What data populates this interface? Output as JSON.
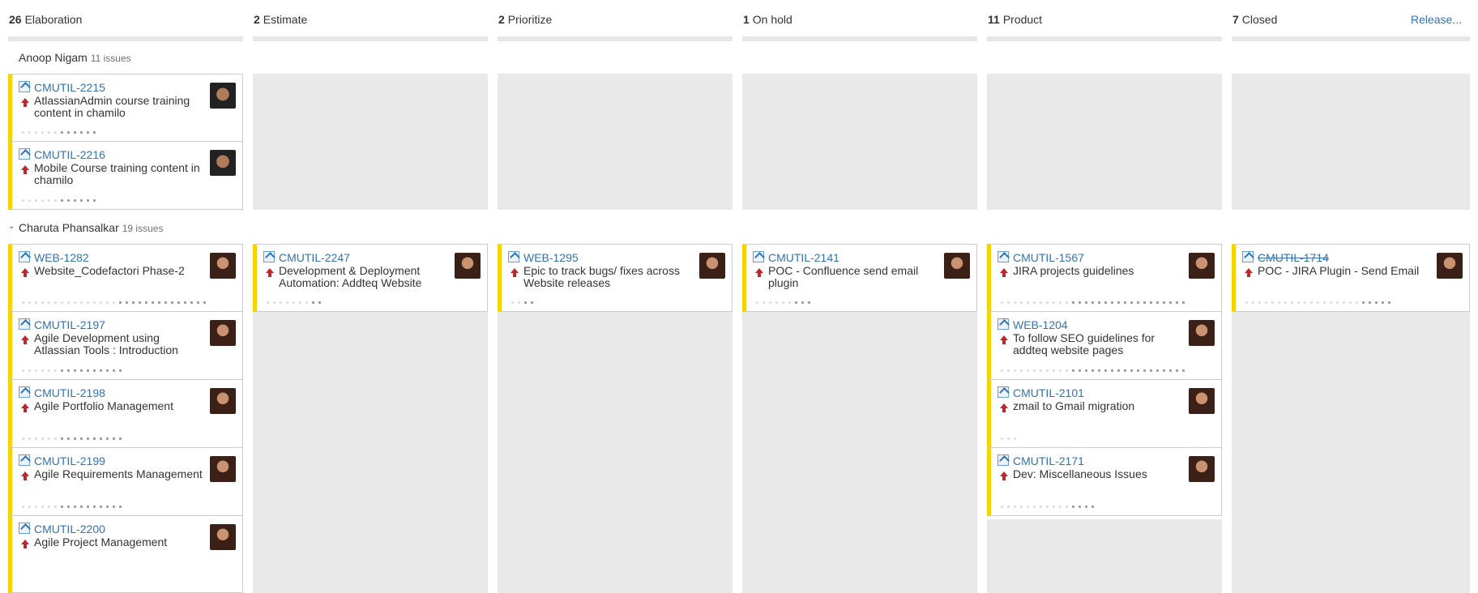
{
  "columns": [
    {
      "count": "26",
      "name": "Elaboration"
    },
    {
      "count": "2",
      "name": "Estimate"
    },
    {
      "count": "2",
      "name": "Prioritize"
    },
    {
      "count": "1",
      "name": "On hold"
    },
    {
      "count": "11",
      "name": "Product"
    },
    {
      "count": "7",
      "name": "Closed"
    }
  ],
  "release_link": "Release...",
  "swimlanes": [
    {
      "name": "Anoop Nigam",
      "count": "11 issues"
    },
    {
      "name": "Charuta Phansalkar",
      "count": "19 issues"
    }
  ],
  "cards": {
    "anoop_elab_1": {
      "key": "CMUTIL-2215",
      "summary": "AtlassianAdmin course training content in chamilo"
    },
    "anoop_elab_2": {
      "key": "CMUTIL-2216",
      "summary": "Mobile Course training content in chamilo"
    },
    "ch_elab_1": {
      "key": "WEB-1282",
      "summary": "Website_Codefactori Phase-2"
    },
    "ch_elab_2": {
      "key": "CMUTIL-2197",
      "summary": "Agile Development using Atlassian Tools : Introduction"
    },
    "ch_elab_3": {
      "key": "CMUTIL-2198",
      "summary": "Agile Portfolio Management"
    },
    "ch_elab_4": {
      "key": "CMUTIL-2199",
      "summary": "Agile Requirements Management"
    },
    "ch_elab_5": {
      "key": "CMUTIL-2200",
      "summary": "Agile Project Management"
    },
    "ch_est_1": {
      "key": "CMUTIL-2247",
      "summary": "Development & Deployment Automation: Addteq Website"
    },
    "ch_pri_1": {
      "key": "WEB-1295",
      "summary": "Epic to track bugs/ fixes across Website releases"
    },
    "ch_hold_1": {
      "key": "CMUTIL-2141",
      "summary": "POC - Confluence send email plugin"
    },
    "ch_prod_1": {
      "key": "CMUTIL-1567",
      "summary": "JIRA projects guidelines"
    },
    "ch_prod_2": {
      "key": "WEB-1204",
      "summary": "To follow SEO guidelines for addteq website pages"
    },
    "ch_prod_3": {
      "key": "CMUTIL-2101",
      "summary": "zmail to Gmail migration"
    },
    "ch_prod_4": {
      "key": "CMUTIL-2171",
      "summary": "Dev: Miscellaneous Issues"
    },
    "ch_closed_1": {
      "key": "CMUTIL-1714",
      "summary": "POC - JIRA Plugin - Send Email"
    }
  },
  "icons": {
    "issue_type": "story-icon",
    "priority": "priority-up-icon",
    "collapse": "chevron-down-icon"
  },
  "colors": {
    "accent": "#3572b0",
    "card_edge": "#f6d400",
    "column_bg": "#e9e9e9",
    "priority": "#c0272d"
  }
}
